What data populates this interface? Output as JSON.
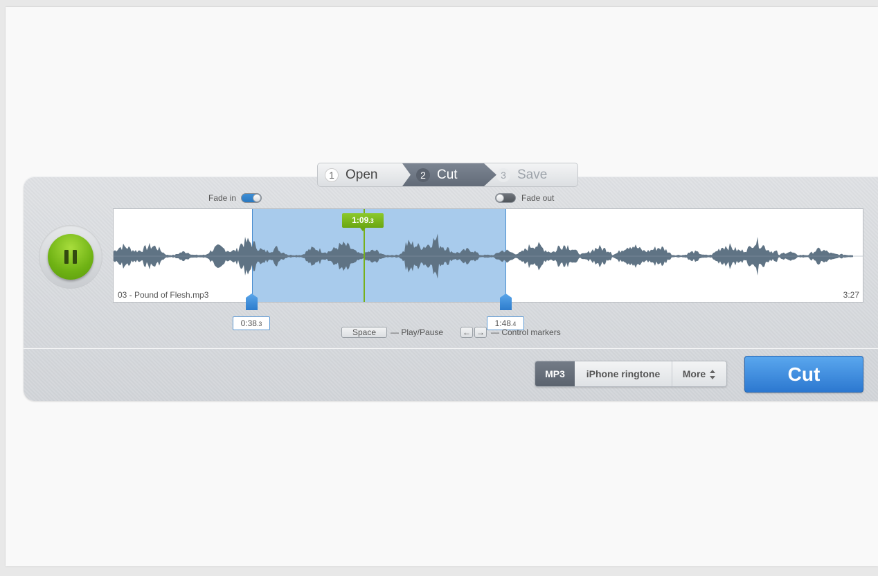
{
  "steps": [
    {
      "num": "1",
      "label": "Open"
    },
    {
      "num": "2",
      "label": "Cut"
    },
    {
      "num": "3",
      "label": "Save"
    }
  ],
  "fade_in": {
    "label": "Fade in",
    "enabled": true
  },
  "fade_out": {
    "label": "Fade out",
    "enabled": false
  },
  "player": {
    "state_icon": "pause-icon"
  },
  "track": {
    "file_name": "03 - Pound of Flesh.mp3",
    "duration": "3:27"
  },
  "cursor": {
    "main": "1:09",
    "frac": ".3"
  },
  "start_marker": {
    "main": "0:38",
    "frac": ".3"
  },
  "end_marker": {
    "main": "1:48",
    "frac": ".4"
  },
  "hints": {
    "space_key": "Space",
    "play_pause": "— Play/Pause",
    "left_key": "←",
    "right_key": "→",
    "control_markers": "— Control markers"
  },
  "formats": {
    "mp3": "MP3",
    "iphone": "iPhone ringtone",
    "more": "More"
  },
  "cut_button": "Cut",
  "colors": {
    "accent_green": "#6fb214",
    "selection_blue": "#a8cbec",
    "cut_blue": "#3d8fe0"
  }
}
